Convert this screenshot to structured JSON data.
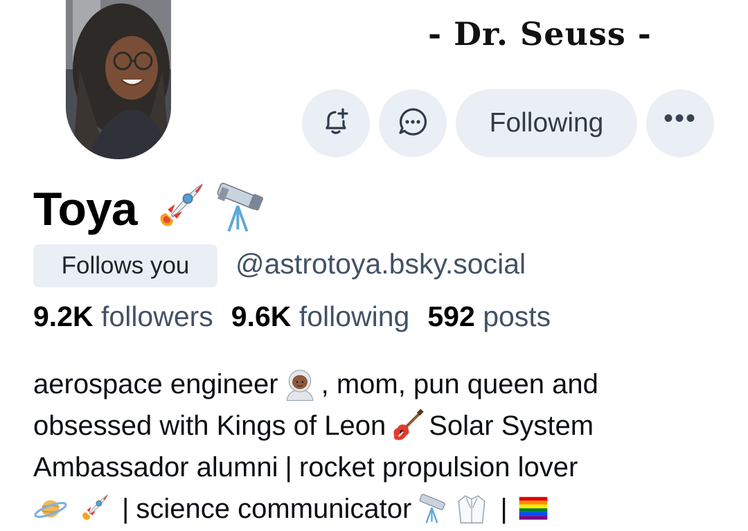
{
  "banner": {
    "quote": "- Dr. Seuss -"
  },
  "profile": {
    "display_name": "Toya",
    "name_emojis": [
      "rocket-emoji",
      "telescope-emoji"
    ],
    "follows_you_label": "Follows you",
    "handle": "@astrotoya.bsky.social"
  },
  "actions": {
    "bell_icon": "bell-plus-icon",
    "message_icon": "message-bubble-icon",
    "following_label": "Following",
    "more_label": "•••"
  },
  "stats": {
    "followers_count": "9.2K",
    "followers_label": "followers",
    "following_count": "9.6K",
    "following_label": "following",
    "posts_count": "592",
    "posts_label": "posts"
  },
  "bio": {
    "line1_a": "aerospace engineer",
    "line1_b": ", mom, pun queen and",
    "line2_a": "obsessed with Kings of Leon",
    "line2_b": "Solar System",
    "line3_a": "Ambassador alumni",
    "line3_sep": "|",
    "line3_b": "rocket propulsion lover",
    "line4_sep1": "|",
    "line4_a": "science communicator",
    "line4_sep2": "|"
  },
  "colors": {
    "button_bg": "#eaeff5",
    "muted_text": "#425266",
    "text": "#000000"
  }
}
